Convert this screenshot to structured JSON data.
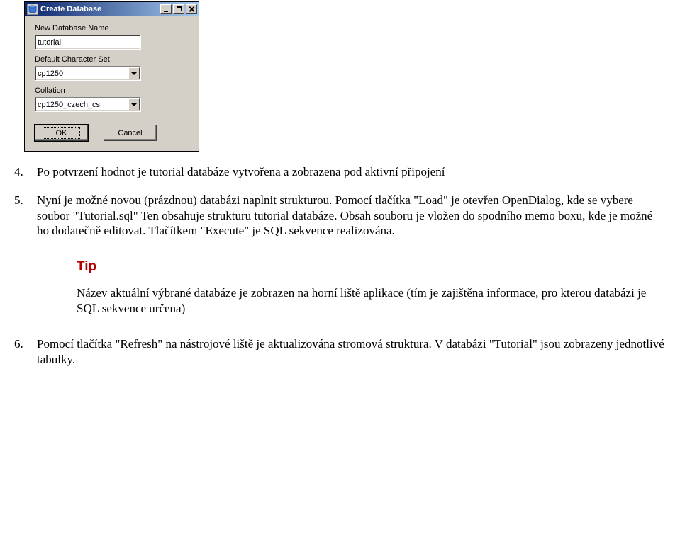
{
  "dialog": {
    "title": "Create Database",
    "fields": {
      "name_label": "New Database Name",
      "name_value": "tutorial",
      "charset_label": "Default Character Set",
      "charset_value": "cp1250",
      "collation_label": "Collation",
      "collation_value": "cp1250_czech_cs"
    },
    "buttons": {
      "ok": "OK",
      "cancel": "Cancel"
    }
  },
  "list": {
    "item4": {
      "num": "4.",
      "text": "Po potvrzení hodnot je tutorial databáze vytvořena a zobrazena pod aktivní připojení"
    },
    "item5": {
      "num": "5.",
      "text": "Nyní je možné novou (prázdnou) databázi naplnit strukturou. Pomocí tlačítka \"Load\" je otevřen OpenDialog, kde se vybere soubor \"Tutorial.sql\" Ten obsahuje strukturu tutorial databáze. Obsah souboru je vložen do spodního memo boxu, kde je možné ho dodatečně editovat. Tlačítkem \"Execute\" je SQL sekvence realizována."
    },
    "item6": {
      "num": "6.",
      "text": "Pomocí tlačítka \"Refresh\" na nástrojové liště je aktualizována stromová struktura. V databázi \"Tutorial\" jsou zobrazeny jednotlivé tabulky."
    }
  },
  "tip": {
    "heading": "Tip",
    "body": "Název aktuální výbrané databáze je zobrazen na horní liště aplikace (tím je zajištěna informace, pro kterou databázi je SQL sekvence určena)"
  }
}
